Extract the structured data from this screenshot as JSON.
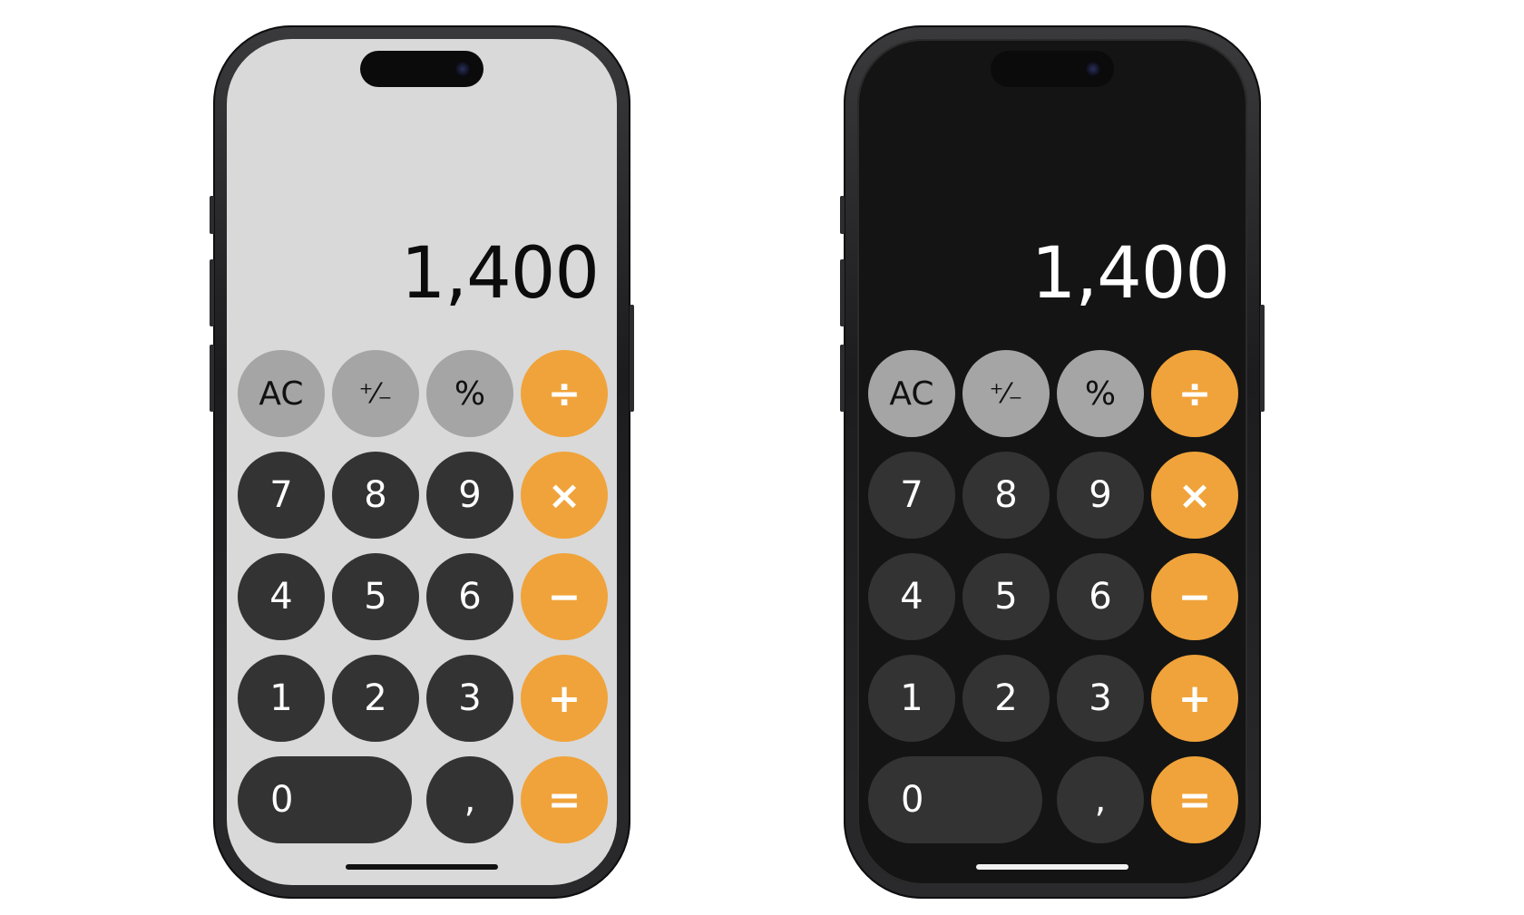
{
  "display_value": "1,400",
  "keys": {
    "ac": "AC",
    "plus_minus": "⁺⁄₋",
    "percent": "%",
    "divide": "÷",
    "seven": "7",
    "eight": "8",
    "nine": "9",
    "multiply": "×",
    "four": "4",
    "five": "5",
    "six": "6",
    "minus": "−",
    "one": "1",
    "two": "2",
    "three": "3",
    "plus": "+",
    "zero": "0",
    "decimal": ",",
    "equals": "="
  },
  "themes": {
    "light": {
      "screen_bg": "#d9d9d9",
      "digit_key": "#333333",
      "function_key": "#a5a5a5",
      "operator_key": "#f0a33a",
      "display_text": "#0c0c0c"
    },
    "dark": {
      "screen_bg": "#141414",
      "digit_key": "#333333",
      "function_key": "#a5a5a5",
      "operator_key": "#f0a33a",
      "display_text": "#ffffff"
    }
  },
  "icons": [
    "dynamic-island",
    "front-camera",
    "home-indicator"
  ]
}
